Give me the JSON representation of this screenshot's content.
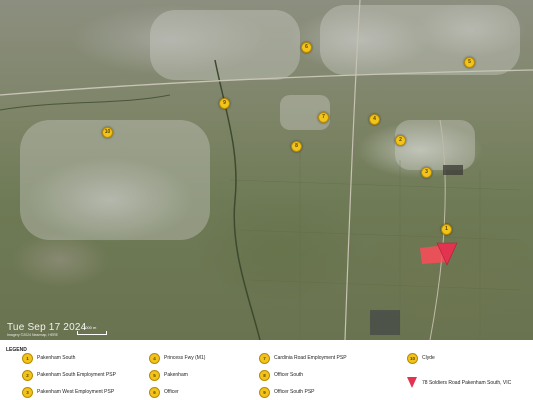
{
  "map": {
    "date_stamp": "Tue Sep 17 2024",
    "imagery_credit": "Imagery ©2024 Nearmap, HERE",
    "scale_label": "1000 m",
    "markers": [
      {
        "number": "1",
        "name": "Pakenham South"
      },
      {
        "number": "2",
        "name": "Pakenham South Employment PSP"
      },
      {
        "number": "3",
        "name": "Pakenham West Employment PSP"
      },
      {
        "number": "4",
        "name": "Princess Fwy (M1)"
      },
      {
        "number": "5",
        "name": "Pakenham"
      },
      {
        "number": "6",
        "name": "Officer"
      },
      {
        "number": "7",
        "name": "Cardinia Road Employment PSP"
      },
      {
        "number": "8",
        "name": "Officer South"
      },
      {
        "number": "9",
        "name": "Officer South PSP"
      },
      {
        "number": "10",
        "name": "Clyde"
      }
    ],
    "subject_pin": "78 Soldiers Road Pakenham South, VIC"
  },
  "legend": {
    "title": "LEGEND",
    "items": [
      {
        "number": "1",
        "label": "Pakenham South"
      },
      {
        "number": "2",
        "label": "Pakenham South Employment PSP"
      },
      {
        "number": "3",
        "label": "Pakenham West Employment PSP"
      },
      {
        "number": "4",
        "label": "Princess Fwy (M1)"
      },
      {
        "number": "5",
        "label": "Pakenham"
      },
      {
        "number": "6",
        "label": "Officer"
      },
      {
        "number": "7",
        "label": "Cardinia Road Employment PSP"
      },
      {
        "number": "8",
        "label": "Officer South"
      },
      {
        "number": "9",
        "label": "Officer South PSP"
      },
      {
        "number": "10",
        "label": "Clyde"
      }
    ],
    "subject_label": "78 Soldiers Road Pakenham South, VIC"
  },
  "colors": {
    "marker": "#f2c31b",
    "pin": "#e23450"
  }
}
